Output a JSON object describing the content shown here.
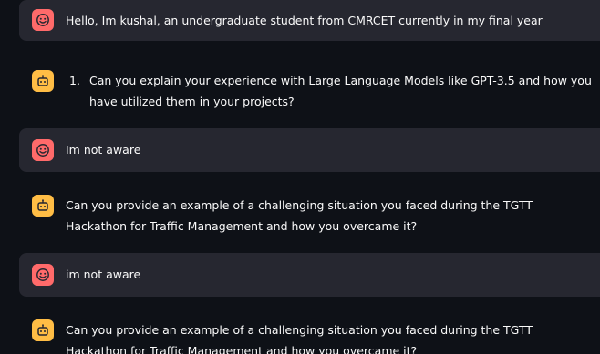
{
  "messages": [
    {
      "role": "user",
      "avatar_icon": "smiley-face-icon",
      "text": "Hello, Im kushal, an undergraduate student from CMRCET currently in my final year"
    },
    {
      "role": "assistant",
      "avatar_icon": "robot-icon",
      "list_number": "1.",
      "text": "Can you explain your experience with Large Language Models like GPT-3.5 and how you have utilized them in your projects?"
    },
    {
      "role": "user",
      "avatar_icon": "smiley-face-icon",
      "text": "Im not aware"
    },
    {
      "role": "assistant",
      "avatar_icon": "robot-icon",
      "text": "Can you provide an example of a challenging situation you faced during the TGTT Hackathon for Traffic Management and how you overcame it?"
    },
    {
      "role": "user",
      "avatar_icon": "smiley-face-icon",
      "text": "im not aware"
    },
    {
      "role": "assistant",
      "avatar_icon": "robot-icon",
      "text": "Can you provide an example of a challenging situation you faced during the TGTT Hackathon for Traffic Management and how you overcame it?"
    }
  ],
  "colors": {
    "background": "#0e1117",
    "user_bubble": "#262730",
    "user_avatar": "#ff6a6a",
    "assistant_avatar": "#ffbd45",
    "text": "#fafafa"
  }
}
